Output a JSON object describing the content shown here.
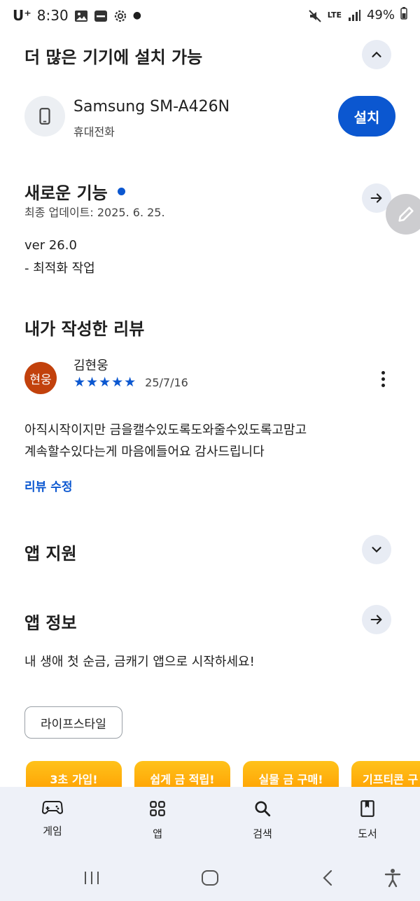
{
  "status_bar": {
    "carrier": "U⁺",
    "time": "8:30",
    "network": "LTE",
    "battery": "49%"
  },
  "more_devices": {
    "title": "더 많은 기기에 설치 가능",
    "device_name": "Samsung SM-A426N",
    "device_type": "휴대전화",
    "install_label": "설치"
  },
  "whats_new": {
    "title": "새로운 기능",
    "updated": "최종 업데이트: 2025. 6. 25.",
    "version": "ver 26.0",
    "notes": "- 최적화 작업"
  },
  "my_review": {
    "title": "내가 작성한 리뷰",
    "avatar_text": "현웅",
    "reviewer": "김현웅",
    "stars": "★★★★★",
    "rating": 5,
    "date": "25/7/16",
    "text_line1": "아직시작이지만 금을캘수있도록도와줄수있도록고맘고",
    "text_line2": "계속할수있다는게 마음에들어요 감사드립니다",
    "edit_label": "리뷰 수정"
  },
  "app_support": {
    "title": "앱 지원"
  },
  "app_info": {
    "title": "앱 정보",
    "description": "내 생애 첫 순금, 금캐기 앱으로 시작하세요!",
    "category": "라이프스타일"
  },
  "promos": [
    "3초 가입!",
    "쉽게 금 적립!",
    "실물 금 구매!",
    "기프티콘 구"
  ],
  "bottom_nav": [
    "게임",
    "앱",
    "검색",
    "도서"
  ],
  "colors": {
    "accent": "#0b57d0",
    "avatar": "#c2410c",
    "promo": "#ffb300"
  }
}
